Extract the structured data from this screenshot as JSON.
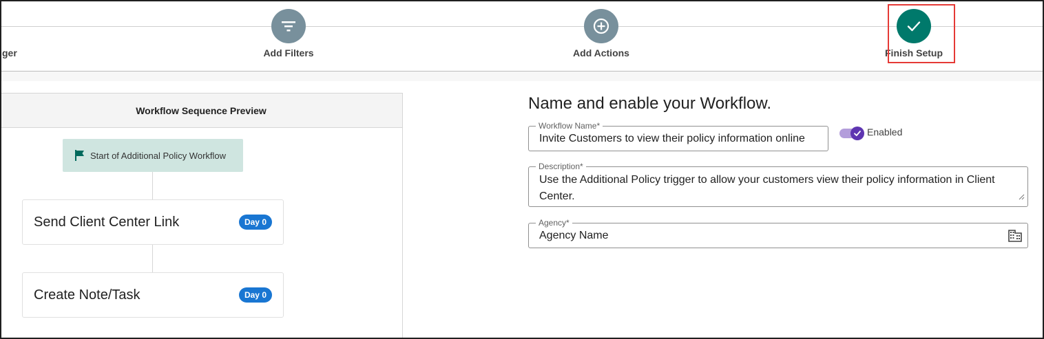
{
  "stepper": {
    "partial_label": "ger",
    "steps": [
      {
        "label": "Add Filters",
        "icon": "filter-icon"
      },
      {
        "label": "Add Actions",
        "icon": "plus-circle-icon"
      },
      {
        "label": "Finish Setup",
        "icon": "check-icon",
        "status": "current"
      }
    ]
  },
  "preview": {
    "header": "Workflow Sequence Preview",
    "start_node": "Start of Additional Policy Workflow",
    "cards": [
      {
        "title": "Send Client Center Link",
        "badge": "Day 0"
      },
      {
        "title": "Create Note/Task",
        "badge": "Day 0"
      }
    ]
  },
  "form": {
    "title": "Name and enable your Workflow.",
    "workflow_name": {
      "label": "Workflow Name*",
      "value": "Invite Customers to view their policy information online"
    },
    "enabled": {
      "label": "Enabled",
      "on": true
    },
    "description": {
      "label": "Description*",
      "value": "Use the Additional Policy trigger to allow your customers view their policy information in Client Center."
    },
    "agency": {
      "label": "Agency*",
      "value": "Agency Name",
      "icon": "building-icon"
    }
  },
  "colors": {
    "step_pending": "#78909c",
    "step_done": "#00796b",
    "highlight": "#e53935",
    "badge": "#1976d2",
    "toggle": "#5e35b1"
  }
}
